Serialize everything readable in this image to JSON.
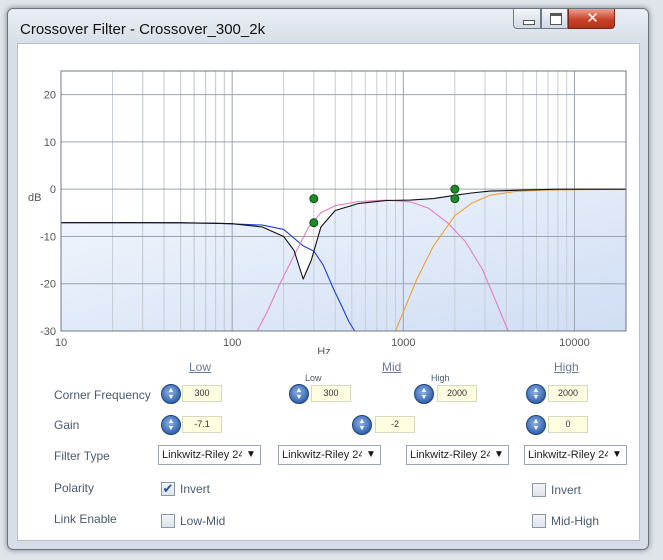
{
  "window": {
    "title": "Crossover Filter - Crossover_300_2k",
    "buttons": {
      "minimize": "minimize-icon",
      "maximize": "maximize-icon",
      "close": "✕"
    }
  },
  "chart_data": {
    "type": "line",
    "x_scale": "log",
    "xlim": [
      10,
      20000
    ],
    "ylim": [
      -30,
      25
    ],
    "grid": true,
    "xlabel": "Hz",
    "ylabel": "dB",
    "x_ticks": [
      "10",
      "100",
      "1000",
      "10000"
    ],
    "x_tick_values": [
      10,
      100,
      1000,
      10000
    ],
    "y_ticks": [
      "20",
      "10",
      "0",
      "-10",
      "-20",
      "-30"
    ],
    "y_tick_values": [
      20,
      10,
      0,
      -10,
      -20,
      -30
    ],
    "series": [
      {
        "color": "#1f3dd6",
        "x": [
          10,
          30,
          80,
          150,
          200,
          260,
          300,
          340,
          390,
          440,
          480,
          520
        ],
        "y": [
          -7.1,
          -7.1,
          -7.2,
          -7.6,
          -8.5,
          -12,
          -13.1,
          -16,
          -21,
          -25,
          -28,
          -30
        ]
      },
      {
        "color": "#e37ec0",
        "x": [
          140,
          160,
          190,
          230,
          280,
          330,
          400,
          550,
          800,
          1100,
          1400,
          1800,
          2300,
          2900,
          3500,
          4100
        ],
        "y": [
          -30,
          -26,
          -20,
          -14,
          -8,
          -5,
          -3.5,
          -2.6,
          -2.3,
          -2.7,
          -4,
          -7,
          -11,
          -17,
          -24,
          -30
        ]
      },
      {
        "color": "#f0a030",
        "x": [
          900,
          1000,
          1200,
          1500,
          2000,
          2500,
          3200,
          4500,
          6500,
          10000,
          20000
        ],
        "y": [
          -30,
          -26,
          -19,
          -12,
          -5.6,
          -3,
          -1.3,
          -0.5,
          -0.2,
          -0.1,
          0
        ]
      },
      {
        "color": "#111111",
        "x": [
          10,
          50,
          100,
          150,
          200,
          230,
          260,
          290,
          330,
          400,
          550,
          800,
          1100,
          1500,
          2000,
          2500,
          3200,
          5000,
          8000,
          20000
        ],
        "y": [
          -7.1,
          -7.1,
          -7.3,
          -8,
          -10,
          -13,
          -19,
          -15,
          -8,
          -4.5,
          -3,
          -2.4,
          -2.3,
          -2,
          -1.3,
          -0.8,
          -0.4,
          -0.2,
          0,
          0
        ]
      }
    ],
    "points": [
      {
        "x": 300,
        "y": -2
      },
      {
        "x": 300,
        "y": -7.1
      },
      {
        "x": 2000,
        "y": 0
      },
      {
        "x": 2000,
        "y": -2
      }
    ]
  },
  "bands": {
    "low": "Low",
    "mid": "Mid",
    "high": "High"
  },
  "rows": {
    "corner_frequency": "Corner Frequency",
    "gain": "Gain",
    "filter_type": "Filter Type",
    "polarity": "Polarity",
    "link_enable": "Link Enable"
  },
  "controls": {
    "low_freq": "300",
    "low_gain": "-7.1",
    "mid_low_label": "Low",
    "mid_low_freq": "300",
    "mid_high_label": "High",
    "mid_high_freq": "2000",
    "mid_gain": "-2",
    "high_freq": "2000",
    "high_gain": "0",
    "filter_low": "Linkwitz-Riley 24",
    "filter_mid_low": "Linkwitz-Riley 24",
    "filter_mid_high": "Linkwitz-Riley 24",
    "filter_high": "Linkwitz-Riley 24",
    "invert_low": "Invert",
    "invert_low_checked": true,
    "invert_high": "Invert",
    "invert_high_checked": false,
    "link_low_mid": "Low-Mid",
    "link_low_mid_checked": false,
    "link_mid_high": "Mid-High",
    "link_mid_high_checked": false
  }
}
